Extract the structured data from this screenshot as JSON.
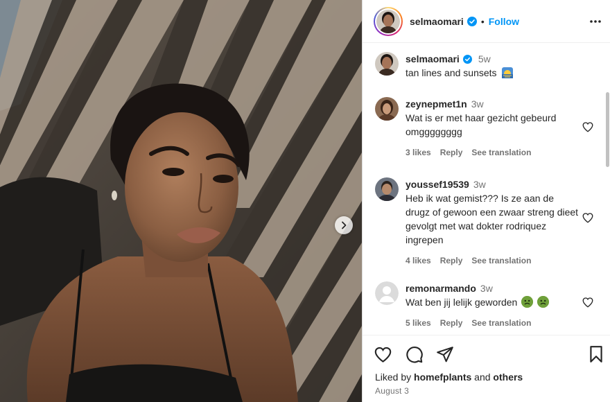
{
  "post": {
    "username": "selmaomari",
    "follow_label": "Follow",
    "caption_time": "5w",
    "caption_text": "tan lines and sunsets",
    "liked_by_prefix": "Liked by ",
    "liked_by_user": "homefplants",
    "liked_by_and": " and ",
    "liked_by_others": "others",
    "date": "August 3"
  },
  "comments": [
    {
      "username": "zeynepmet1n",
      "time": "3w",
      "text": "Wat is er met haar gezicht gebeurd omgggggggg",
      "likes": "3 likes",
      "reply": "Reply",
      "translate": "See translation"
    },
    {
      "username": "youssef19539",
      "time": "3w",
      "text": "Heb ik wat gemist??? Is ze aan de drugz of gewoon een zwaar streng dieet gevolgt met wat dokter rodriquez ingrepen",
      "likes": "4 likes",
      "reply": "Reply",
      "translate": "See translation"
    },
    {
      "username": "remonarmando",
      "time": "3w",
      "text": "Wat ben jij lelijk geworden",
      "likes": "5 likes",
      "reply": "Reply",
      "translate": "See translation"
    }
  ],
  "colors": {
    "accent": "#0095f6",
    "secondary_text": "#737373",
    "primary_text": "#262626",
    "verified": "#0095f6"
  },
  "icons": {
    "like": "heart-icon",
    "comment": "comment-icon",
    "share": "paper-plane-icon",
    "save": "bookmark-icon",
    "more": "more-options-icon",
    "next": "chevron-right-icon"
  }
}
